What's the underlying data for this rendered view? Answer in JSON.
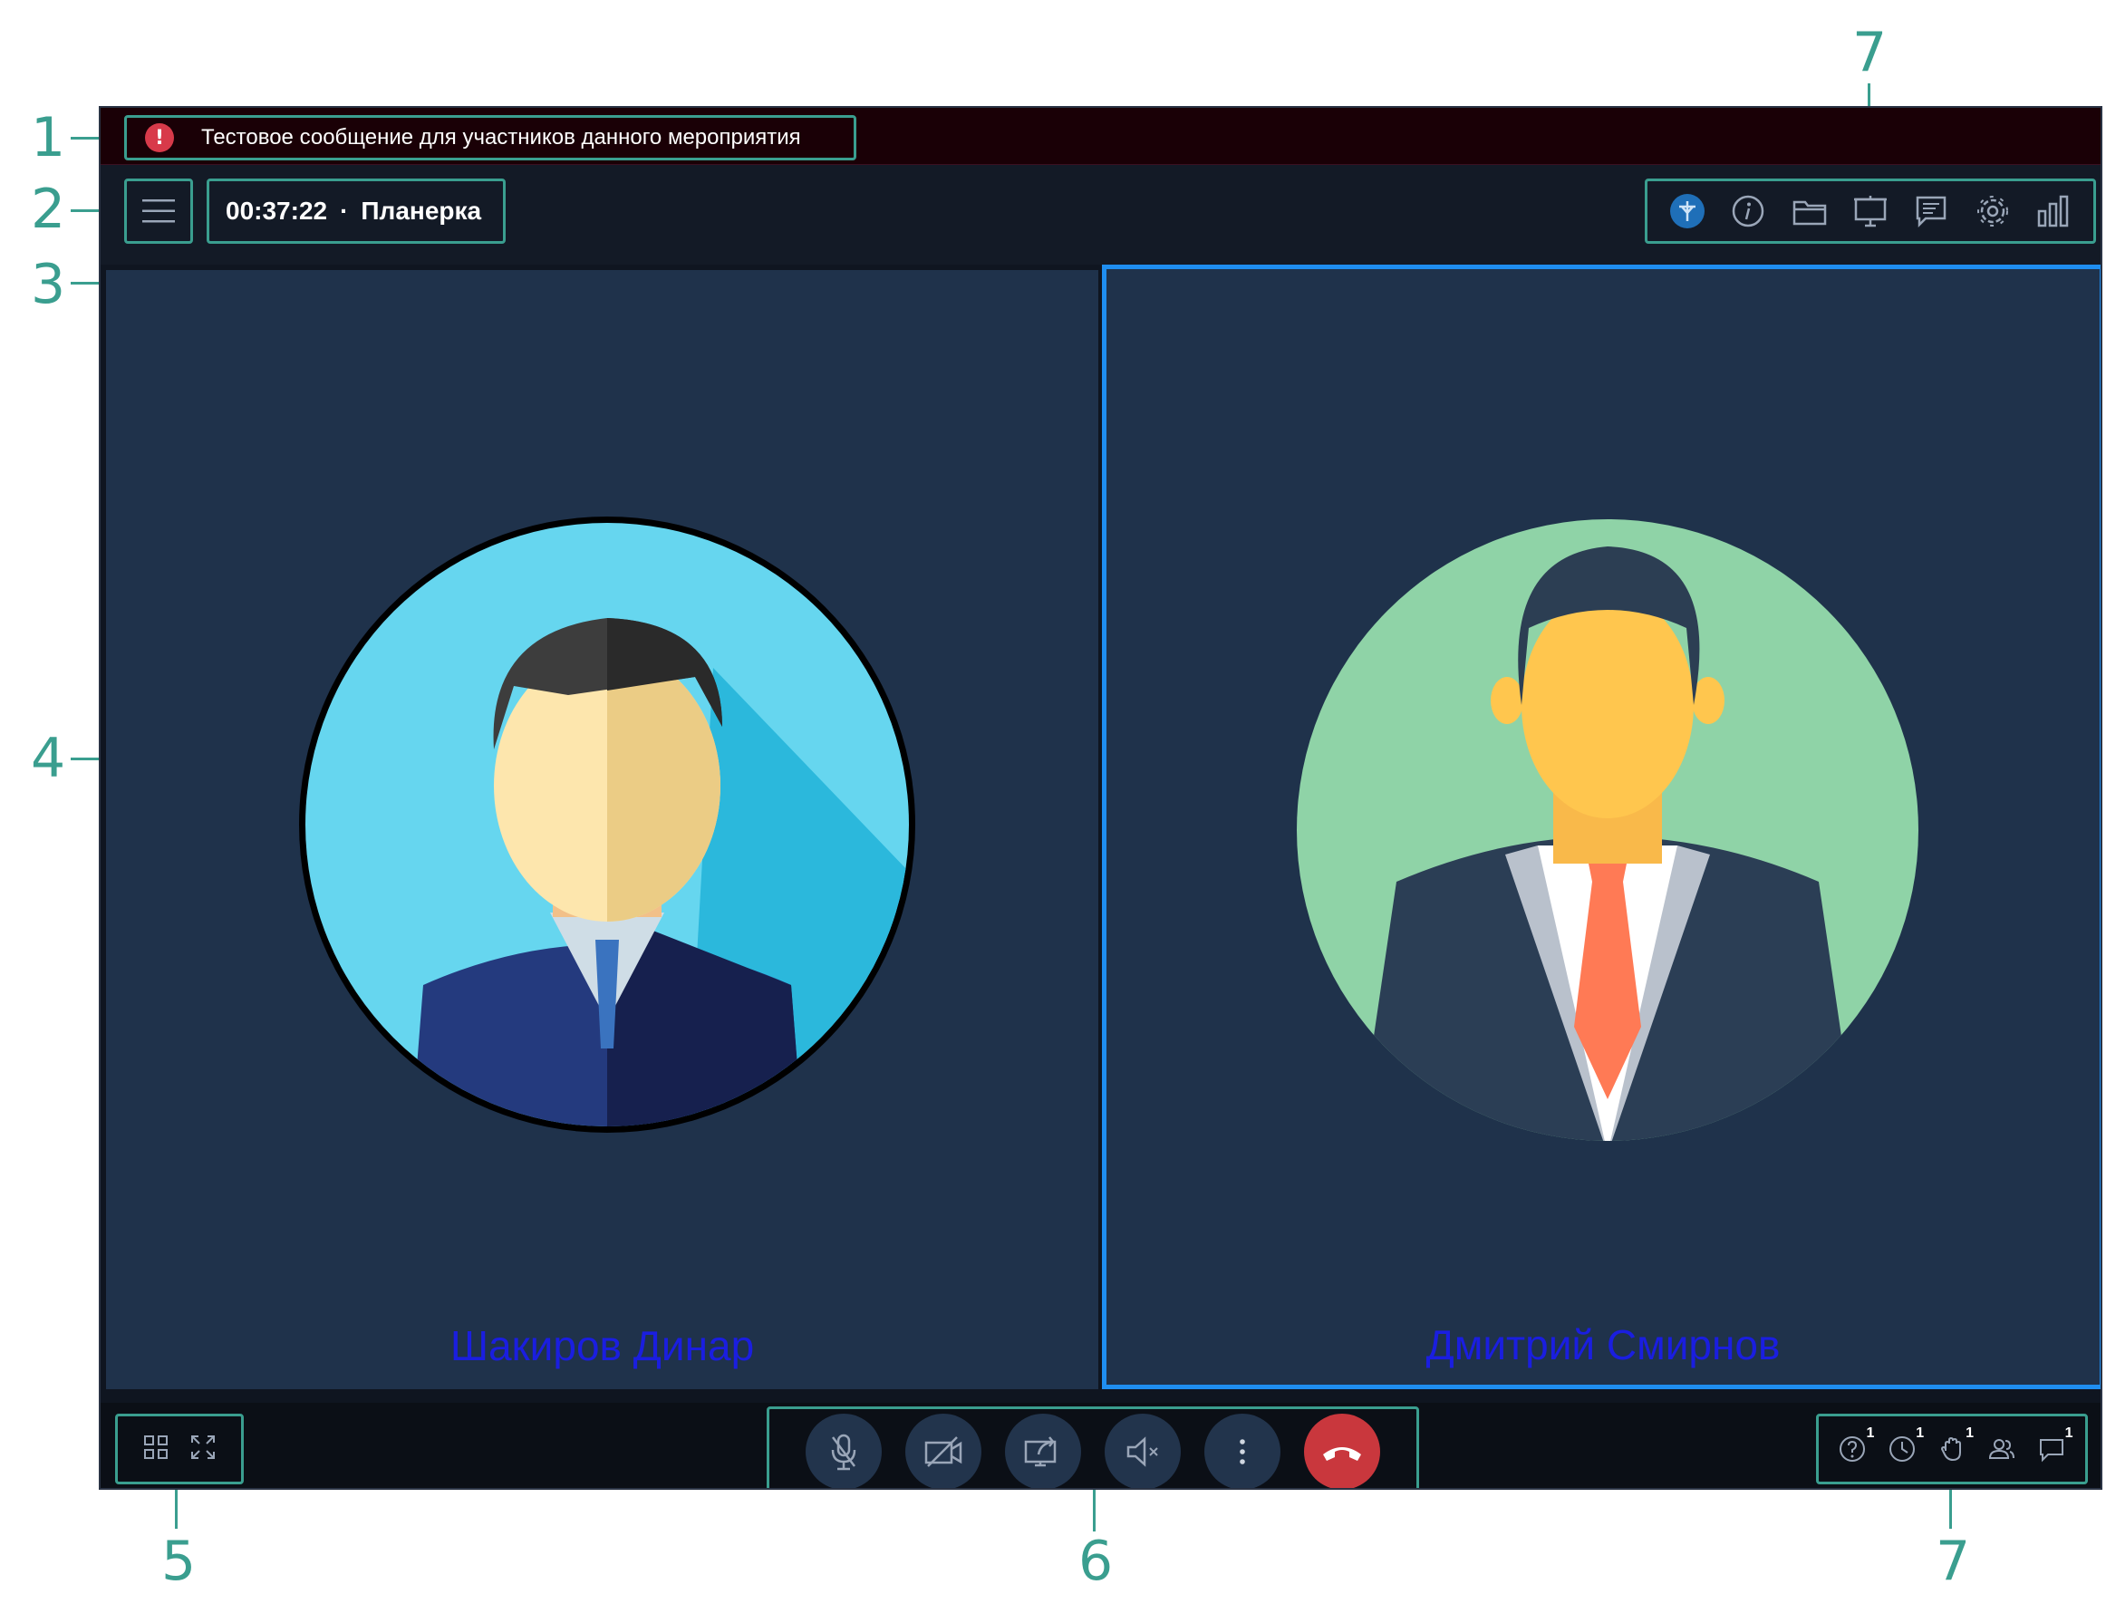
{
  "callouts": [
    "1",
    "2",
    "3",
    "4",
    "5",
    "6",
    "7",
    "7"
  ],
  "banner": {
    "text": "Тестовое сообщение для участников данного мероприятия",
    "icon": "alert-icon",
    "icon_glyph": "!"
  },
  "header": {
    "timer": "00:37:22",
    "separator": "·",
    "title": "Планерка"
  },
  "toolbar": [
    "network-icon",
    "info-icon",
    "folder-icon",
    "presentation-icon",
    "notes-icon",
    "settings-icon",
    "stats-icon"
  ],
  "participants": [
    {
      "name": "Шакиров Динар",
      "active": false
    },
    {
      "name": "Дмитрий Смирнов",
      "active": true
    }
  ],
  "layout_controls": [
    "grid-icon",
    "fullscreen-icon"
  ],
  "controls": [
    "microphone-icon",
    "camera-off-icon",
    "screen-share-icon",
    "speaker-muted-icon",
    "more-icon",
    "hang-up-icon"
  ],
  "stats": [
    {
      "icon": "question-icon",
      "count": "1"
    },
    {
      "icon": "clock-icon",
      "count": "1"
    },
    {
      "icon": "hand-icon",
      "count": "1"
    },
    {
      "icon": "users-icon",
      "count": ""
    },
    {
      "icon": "chat-icon",
      "count": "1"
    }
  ],
  "colors": {
    "accent": "#3a9e8f",
    "active_border": "#1f8ef0",
    "hangup": "#c9373d",
    "name_text": "#1a1ee0"
  }
}
